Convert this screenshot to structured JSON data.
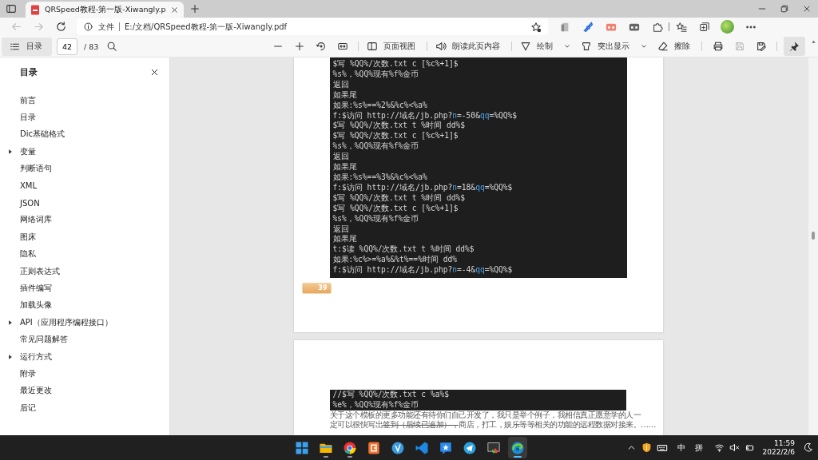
{
  "browser": {
    "tab": {
      "title": "QRSpeed教程-第一版-Xiwangly.p",
      "selected": true
    },
    "nav": [
      {
        "kind": "back",
        "disabled": true
      },
      {
        "kind": "forward",
        "disabled": true
      },
      {
        "kind": "refresh",
        "disabled": false
      }
    ],
    "address": {
      "label": "文件",
      "url": "E:/文档/QRSpeed教程-第一版-Xiwangly.pdf"
    }
  },
  "pdf_toolbar": {
    "contents_button": "目录",
    "page": "42",
    "page_total": "/ 83",
    "tools": [
      {
        "kind": "view",
        "label": "页面视图",
        "dropdown": false
      },
      {
        "kind": "read",
        "label": "朗读此页内容",
        "dropdown": false
      },
      {
        "kind": "draw",
        "label": "绘制",
        "dropdown": true
      },
      {
        "kind": "highlight",
        "label": "突出显示",
        "dropdown": true
      },
      {
        "kind": "erase",
        "label": "擦除",
        "dropdown": false
      }
    ],
    "actions": [
      {
        "kind": "print",
        "disabled": false
      },
      {
        "kind": "save",
        "disabled": true
      },
      {
        "kind": "save-as",
        "disabled": false
      }
    ],
    "pin": {
      "pressed": true
    }
  },
  "sidebar": {
    "title": "目录",
    "items": [
      {
        "label": "前言",
        "expandable": false
      },
      {
        "label": "目录",
        "expandable": false
      },
      {
        "label": "Dic基础格式",
        "expandable": false
      },
      {
        "label": "变量",
        "expandable": true
      },
      {
        "label": "判断语句",
        "expandable": false
      },
      {
        "label": "XML",
        "expandable": false
      },
      {
        "label": "JSON",
        "expandable": false
      },
      {
        "label": "网络词库",
        "expandable": false
      },
      {
        "label": "图床",
        "expandable": false
      },
      {
        "label": "隐私",
        "expandable": false
      },
      {
        "label": "正则表达式",
        "expandable": false
      },
      {
        "label": "插件编写",
        "expandable": false
      },
      {
        "label": "加载头像",
        "expandable": false
      },
      {
        "label": "API（应用程序编程接口）",
        "expandable": true
      },
      {
        "label": "常见问题解答",
        "expandable": false
      },
      {
        "label": "运行方式",
        "expandable": true
      },
      {
        "label": "附录",
        "expandable": false
      },
      {
        "label": "最近更改",
        "expandable": false
      },
      {
        "label": "后记",
        "expandable": false
      }
    ]
  },
  "pages": [
    {
      "code": [
        [
          {
            "text": "$写 %QQ%/次数.txt c [%c%+1]$",
            "kind": "plain"
          }
        ],
        [
          {
            "text": "%s%，%QQ%现有%f%金币",
            "kind": "plain"
          }
        ],
        [
          {
            "text": "返回",
            "kind": "plain"
          }
        ],
        [
          {
            "text": "如果尾",
            "kind": "plain"
          }
        ],
        [
          {
            "text": "如果:%s%==%2%&%c%<%a%",
            "kind": "plain"
          }
        ],
        [
          {
            "text": "f:$访问 http://域名/jb.php?",
            "kind": "plain"
          },
          {
            "text": "n",
            "kind": "param"
          },
          {
            "text": "=-50&",
            "kind": "plain"
          },
          {
            "text": "qq",
            "kind": "param"
          },
          {
            "text": "=%QQ%$",
            "kind": "plain"
          }
        ],
        [
          {
            "text": "$写 %QQ%/次数.txt t %时间 dd%$",
            "kind": "plain"
          }
        ],
        [
          {
            "text": "$写 %QQ%/次数.txt c [%c%+1]$",
            "kind": "plain"
          }
        ],
        [
          {
            "text": "%s%，%QQ%现有%f%金币",
            "kind": "plain"
          }
        ],
        [
          {
            "text": "返回",
            "kind": "plain"
          }
        ],
        [
          {
            "text": "如果尾",
            "kind": "plain"
          }
        ],
        [
          {
            "text": "如果:%s%==%3%&%c%<%a%",
            "kind": "plain"
          }
        ],
        [
          {
            "text": "f:$访问 http://域名/jb.php?",
            "kind": "plain"
          },
          {
            "text": "n",
            "kind": "param"
          },
          {
            "text": "=18&",
            "kind": "plain"
          },
          {
            "text": "qq",
            "kind": "param"
          },
          {
            "text": "=%QQ%$",
            "kind": "plain"
          }
        ],
        [
          {
            "text": "$写 %QQ%/次数.txt t %时间 dd%$",
            "kind": "plain"
          }
        ],
        [
          {
            "text": "$写 %QQ%/次数.txt c [%c%+1]$",
            "kind": "plain"
          }
        ],
        [
          {
            "text": "%s%，%QQ%现有%f%金币",
            "kind": "plain"
          }
        ],
        [
          {
            "text": "返回",
            "kind": "plain"
          }
        ],
        [
          {
            "text": "如果尾",
            "kind": "plain"
          }
        ],
        [
          {
            "text": "t:$读 %QQ%/次数.txt t %时间 dd%$",
            "kind": "plain"
          }
        ],
        [
          {
            "text": "如果:%c%>=%a%&%t%==%时间 dd%",
            "kind": "plain"
          }
        ],
        [
          {
            "text": "f:$访问 http://域名/jb.php?",
            "kind": "plain"
          },
          {
            "text": "n",
            "kind": "param"
          },
          {
            "text": "=-4&",
            "kind": "plain"
          },
          {
            "text": "qq",
            "kind": "param"
          },
          {
            "text": "=%QQ%$",
            "kind": "plain"
          }
        ]
      ],
      "page_number": "39"
    },
    {
      "code": [
        [
          {
            "text": "//$写 %QQ%/次数.txt c %a%$",
            "kind": "plain"
          }
        ],
        [
          {
            "text": "%e%，%QQ%现有%f%金币",
            "kind": "plain"
          }
        ]
      ],
      "paragraph": [
        [
          {
            "text": "关于这个模板的更多功能还有待你们自己开发了，我只是举个例子，我相信真正愿意学的人一",
            "struck": false
          }
        ],
        [
          {
            "text": "定可以很快写出",
            "struck": false
          },
          {
            "text": "签到（后续已追加），",
            "struck": true
          },
          {
            "text": "商店，打工，娱乐等等相关的功能的远程数据对接来。……",
            "struck": false
          }
        ]
      ]
    }
  ],
  "taskbar": {
    "apps": [
      {
        "kind": "start",
        "running": false,
        "selected": false
      },
      {
        "kind": "folder",
        "running": true,
        "selected": false
      },
      {
        "kind": "chrome",
        "running": true,
        "selected": false
      },
      {
        "kind": "sheet",
        "running": false,
        "selected": false
      },
      {
        "kind": "v-app",
        "running": false,
        "selected": false
      },
      {
        "kind": "code",
        "running": false,
        "selected": false
      },
      {
        "kind": "star-chat",
        "running": false,
        "selected": false
      },
      {
        "kind": "telegram",
        "running": false,
        "selected": false
      },
      {
        "kind": "screen-tool",
        "running": false,
        "selected": false
      },
      {
        "kind": "edge",
        "running": true,
        "selected": true
      }
    ],
    "ime_mode": "中",
    "ime": "拼",
    "time": "11:59",
    "date": "2022/2/6"
  }
}
